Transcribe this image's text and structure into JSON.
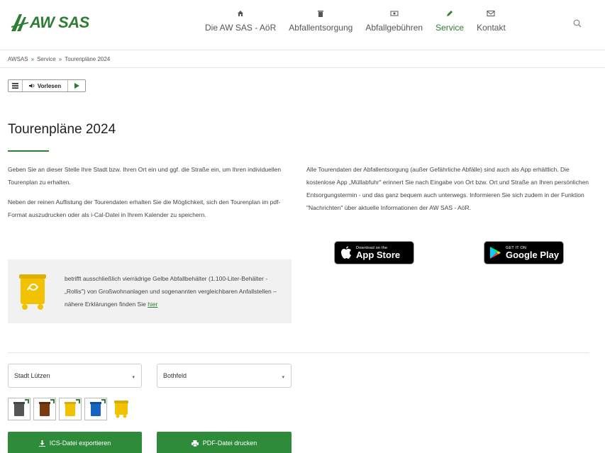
{
  "header": {
    "logo_text": "AW SAS",
    "nav": [
      {
        "label": "Die AW SAS - AöR",
        "icon": "home-icon"
      },
      {
        "label": "Abfallentsorgung",
        "icon": "trash-icon"
      },
      {
        "label": "Abfallgebühren",
        "icon": "money-icon"
      },
      {
        "label": "Service",
        "icon": "pencil-icon",
        "active": true
      },
      {
        "label": "Kontakt",
        "icon": "mail-icon"
      }
    ],
    "search_icon": "search-icon"
  },
  "breadcrumb": {
    "items": [
      "AWSAS",
      "Service",
      "Tourenpläne 2024"
    ],
    "separator": "»"
  },
  "readspeaker": {
    "menu_icon": "menu-icon",
    "listen_label": "Vorlesen",
    "play_icon": "play-icon"
  },
  "page": {
    "title": "Tourenpläne 2024",
    "left_para_1": "Geben Sie an dieser Stelle Ihre Stadt bzw. Ihren Ort ein und ggf. die Straße ein, um Ihren individuellen Tourenplan zu erhalten.",
    "left_para_2": "Neben der reinen Auflistung der Tourendaten erhalten Sie die Möglichkeit, sich den Tourenplan im pdf-Format auszudrucken oder als i-Cal-Datei in Ihrem Kalender zu speichern.",
    "right_para": "Alle Tourendaten der Abfallentsorgung (außer Gefährliche Abfälle) sind auch als App erhältlich. Die kostenlose App „Müllabfuhr\" erinnert Sie nach Eingabe von Ort bzw. Ort und Straße an Ihren persönlichen Entsorgungstermin - und das ganz bequem auch unterwegs. Informieren Sie sich zudem in der Funktion \"Nachrichten\" über aktuelle Informationen der AW SAS - AöR.",
    "notice_text": "betrifft ausschließlich vierrädrige Gelbe Abfallbehälter (1.100-Liter-Behälter - „Rollis\") von Großwohnanlagen und sogenannten vergleichbaren Anfallstellen – nähere Erklärungen finden Sie",
    "notice_link": "hier"
  },
  "store_badges": {
    "appstore_small": "Download on the",
    "appstore_big": "App Store",
    "googleplay_small": "GET IT ON",
    "googleplay_big": "Google Play"
  },
  "filters": {
    "city_value": "Stadt Lützen",
    "street_value": "Bothfeld"
  },
  "bins": [
    {
      "name": "Restabfall",
      "color": "#555555",
      "checked": true
    },
    {
      "name": "Bioabfall",
      "color": "#7a3b12",
      "checked": true
    },
    {
      "name": "Gelbe Tonne",
      "color": "#f2c200",
      "checked": true
    },
    {
      "name": "Papier",
      "color": "#1565c0",
      "checked": true
    },
    {
      "name": "Rollis",
      "color": "#f2c200",
      "checked": false
    }
  ],
  "buttons": {
    "ics_label": "ICS-Datei exportieren",
    "pdf_label": "PDF-Datei drucken"
  },
  "colors": {
    "brand_green": "#2e7d32",
    "button_green": "#2e8b3a"
  }
}
